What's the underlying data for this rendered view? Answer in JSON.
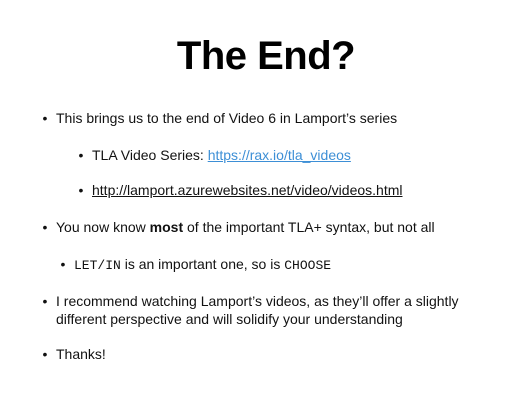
{
  "slide": {
    "title": "The End?",
    "bullet_symbol": "•",
    "bullets": {
      "b1": {
        "text": "This brings us to the end of Video 6 in Lamport’s series"
      },
      "b1a": {
        "prefix": "TLA Video Series: ",
        "link": "https://rax.io/tla_videos"
      },
      "b1b": {
        "link": "http://lamport.azurewebsites.net/video/videos.html"
      },
      "b2": {
        "before": "You now know ",
        "bold": "most",
        "after": " of the important TLA+ syntax, but not all"
      },
      "b2a": {
        "code1": "LET/IN",
        "middle": " is an important one, so is ",
        "code2": "CHOOSE"
      },
      "b3": {
        "text": "I recommend watching Lamport’s videos, as they’ll offer a slightly different perspective and will solidify your understanding"
      },
      "b4": {
        "text": "Thanks!"
      }
    }
  },
  "colors": {
    "link": "#3d8fd6",
    "text": "#111111",
    "background": "#ffffff"
  }
}
